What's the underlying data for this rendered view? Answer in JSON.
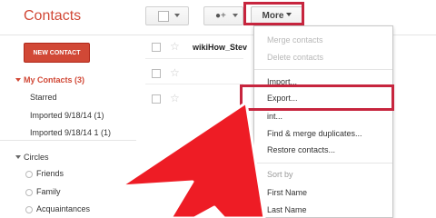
{
  "header": {
    "app_title": "Contacts",
    "more_label": "More"
  },
  "sidebar": {
    "new_contact": "NEW CONTACT",
    "my_contacts": "My Contacts (3)",
    "starred": "Starred",
    "imported1": "Imported 9/18/14 (1)",
    "imported2": "Imported 9/18/14 1 (1)",
    "circles": "Circles",
    "friends": "Friends",
    "family": "Family",
    "acquaintances": "Acquaintances"
  },
  "contacts": {
    "first_name": "wikiHow_Stev"
  },
  "menu": {
    "merge": "Merge contacts",
    "delete": "Delete contacts",
    "import": "Import...",
    "export": "Export...",
    "print": "int...",
    "find_merge": "Find & merge duplicates...",
    "restore": "Restore contacts...",
    "sort_by": "Sort by",
    "first_name": "First Name",
    "last_name": "Last Name"
  },
  "colors": {
    "accent_red": "#d14836",
    "highlight_red": "#c7253e",
    "arrow_red": "#ee1c25"
  }
}
